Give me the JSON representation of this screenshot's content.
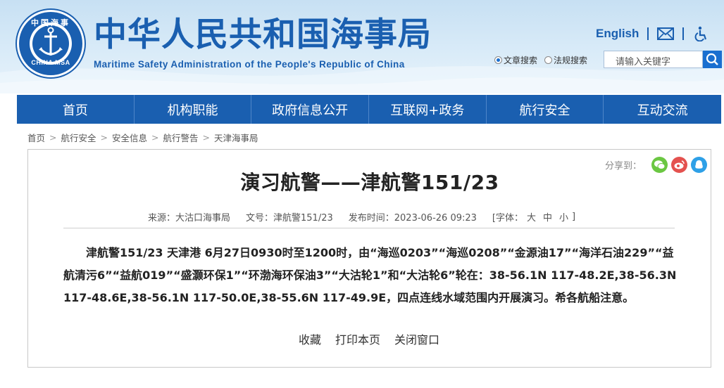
{
  "header": {
    "title": "中华人民共和国海事局",
    "subtitle": "Maritime Safety Administration of the People's Republic of China",
    "logo_top": "中国海事",
    "logo_bottom": "CHINA MSA",
    "english_link": "English",
    "mail_icon": "mail-icon",
    "accessibility_icon": "accessibility-icon"
  },
  "search": {
    "radio_article": "文章搜索",
    "radio_law": "法规搜索",
    "selected": "文章搜索",
    "placeholder": "请输入关键字",
    "icon": "search-icon"
  },
  "nav": {
    "items": [
      "首页",
      "机构职能",
      "政府信息公开",
      "互联网+政务",
      "航行安全",
      "互动交流"
    ]
  },
  "breadcrumb": [
    "首页",
    "航行安全",
    "安全信息",
    "航行警告",
    "天津海事局"
  ],
  "share": {
    "label": "分享到：",
    "icons": [
      "wechat-icon",
      "weibo-icon",
      "qq-icon"
    ]
  },
  "article": {
    "title": "演习航警——津航警151/23",
    "source": "来源：大沽口海事局",
    "doc_no": "文号：津航警151/23",
    "date": "发布时间：2023-06-26 09:23",
    "font_label": "[字体：",
    "font_large": "大",
    "font_medium": "中",
    "font_small": "小",
    "font_close": "]",
    "body": "津航警151/23 天津港 6月27日0930时至1200时，由“海巡0203”“海巡0208”“金源油17”“海洋石油229”“益航清污6”“益航019”“盛灏环保1”“环渤海环保油3”“大沽轮1”和“大沽轮6”轮在：38-56.1N 117-48.2E,38-56.3N 117-48.6E,38-56.1N 117-50.0E,38-55.6N 117-49.9E，四点连线水域范围内开展演习。希各航船注意。"
  },
  "actions": {
    "favorite": "收藏",
    "print": "打印本页",
    "close": "关闭窗口"
  },
  "colors": {
    "brand_blue": "#1a5fb0",
    "nav_bg": "#1a5fb0",
    "header_bg": "#d9ebf8"
  }
}
